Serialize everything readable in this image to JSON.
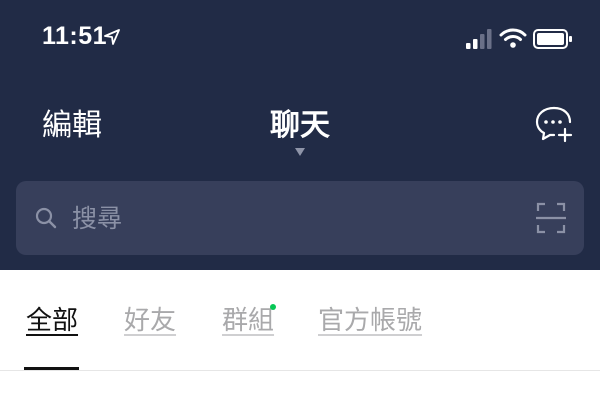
{
  "status_bar": {
    "time": "11:51",
    "location_icon": "location-arrow-icon",
    "signal_icon": "cellular-signal-icon",
    "wifi_icon": "wifi-icon",
    "battery_icon": "battery-icon"
  },
  "header": {
    "edit_label": "編輯",
    "title": "聊天",
    "title_caret_icon": "caret-down-icon",
    "new_chat_icon": "new-chat-icon"
  },
  "search": {
    "placeholder": "搜尋",
    "search_icon": "search-icon",
    "scan_icon": "scan-icon"
  },
  "tabs": [
    {
      "label": "全部",
      "active": true
    },
    {
      "label": "好友",
      "active": false
    },
    {
      "label": "群組",
      "active": false,
      "has_notification_dot": true
    },
    {
      "label": "官方帳號",
      "active": false
    }
  ],
  "colors": {
    "header_bg": "#212b46",
    "search_bg": "#373f5b",
    "notification_dot": "#06c755",
    "active_tab": "#111111",
    "inactive_tab": "#a9a9ab"
  }
}
